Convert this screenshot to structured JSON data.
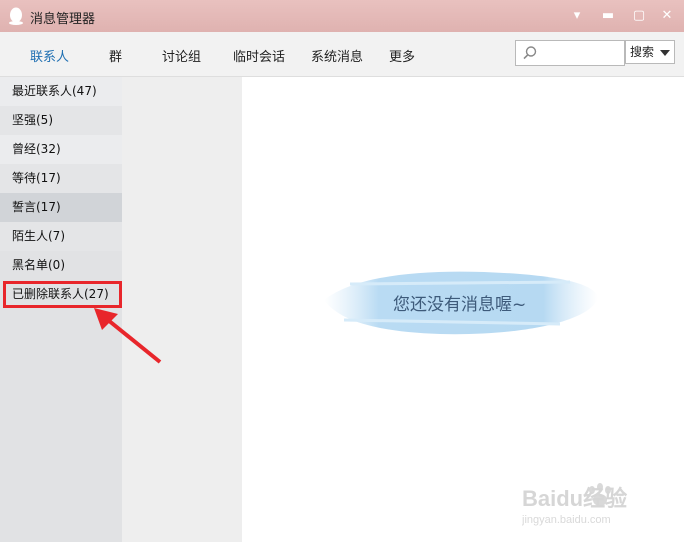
{
  "window": {
    "title": "消息管理器"
  },
  "tabs": [
    "联系人",
    "群",
    "讨论组",
    "临时会话",
    "系统消息",
    "更多"
  ],
  "search": {
    "value": "",
    "button_label": "搜索"
  },
  "groups": [
    "最近联系人(47)",
    "坚强(5)",
    "曾经(32)",
    "等待(17)",
    "誓言(17)",
    "陌生人(7)",
    "黑名单(0)",
    "已删除联系人(27)"
  ],
  "empty_message": "您还没有消息喔~",
  "watermark": {
    "brand": "Baidu经验",
    "url": "jingyan.baidu.com"
  },
  "colors": {
    "titlebar": "#e9c1bf",
    "active_tab": "#1f6fb2",
    "annotation": "#e8262b"
  }
}
